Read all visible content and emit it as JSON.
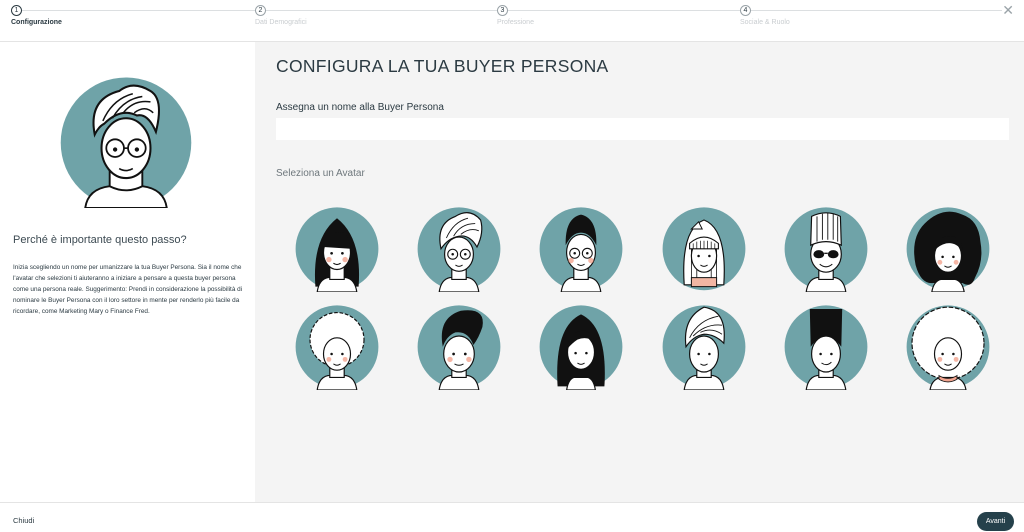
{
  "stepper": {
    "steps": [
      {
        "number": "1",
        "label": "Configurazione"
      },
      {
        "number": "2",
        "label": "Dati Demografici"
      },
      {
        "number": "3",
        "label": "Professione"
      },
      {
        "number": "4",
        "label": "Sociale & Ruolo"
      }
    ],
    "active_step": 1,
    "line_color": "#dcdfe1"
  },
  "left": {
    "hero_avatar": "avatar-curly-top-glasses-icon",
    "why_title": "Perché è importante questo passo?",
    "why_text": "Inizia scegliendo un nome per umanizzare la tua Buyer Persona. Sia il nome che l'avatar che selezioni ti aiuteranno a iniziare a pensare a questa buyer persona come una persona reale. Suggerimento: Prendi in considerazione la possibilità di nominare le Buyer Persona con il loro settore in mente per renderlo più facile da ricordare, come Marketing Mary o Finance Fred."
  },
  "main": {
    "title": "CONFIGURA LA TUA BUYER PERSONA",
    "name_label": "Assegna un nome alla Buyer Persona",
    "name_value": "",
    "avatar_label": "Seleziona un Avatar",
    "avatar_circle_color": "#6fa3a8",
    "avatars": [
      "avatar-long-black-hair-icon",
      "avatar-swirl-hair-glasses-icon",
      "avatar-short-hair-round-glasses-icon",
      "avatar-bangs-headband-icon",
      "avatar-quiff-sunglasses-icon",
      "avatar-big-wavy-hair-icon",
      "avatar-afro-curly-icon",
      "avatar-pompadour-icon",
      "avatar-long-straight-hair-icon",
      "avatar-wrapped-hair-icon",
      "avatar-flat-top-icon",
      "avatar-curly-afro-necklace-icon"
    ]
  },
  "footer": {
    "close_label": "Chiudi",
    "next_label": "Avanti",
    "next_color": "#25414b"
  }
}
